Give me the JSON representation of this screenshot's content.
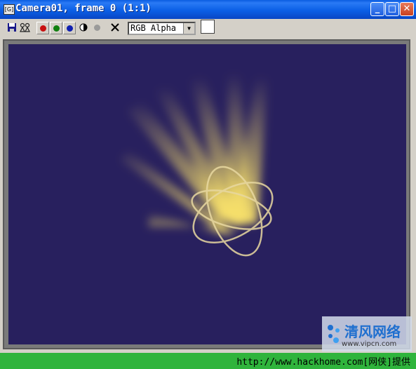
{
  "window": {
    "title": "Camera01, frame 0 (1:1)",
    "icon_glyph": "[G]"
  },
  "toolbar": {
    "channel_display": "RGB Alpha",
    "channel_buttons": [
      {
        "name": "red-channel",
        "color": "#c81010"
      },
      {
        "name": "green-channel",
        "color": "#108010"
      },
      {
        "name": "blue-channel",
        "color": "#1020b0"
      }
    ]
  },
  "render": {
    "background": "#28205e",
    "glow_color": "#f0d050"
  },
  "watermark": {
    "brand": "清风网络",
    "url": "www.vipcn.com"
  },
  "footer": {
    "text": "http://www.hackhome.com[网侠]提供"
  }
}
